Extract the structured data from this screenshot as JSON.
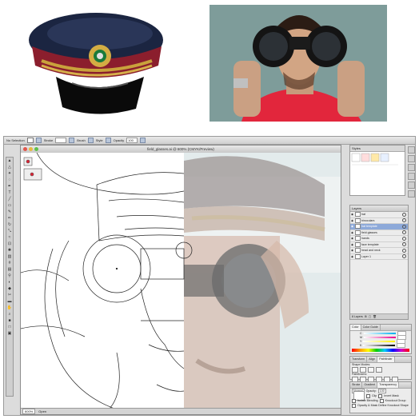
{
  "control_bar": {
    "selection": "No Selection",
    "stroke_label": "Stroke",
    "brush_label": "Brush",
    "style_label": "Style",
    "opacity_label": "Opacity",
    "opacity_value": "100"
  },
  "document": {
    "title": "field_glasses.ai @ 600% (CMYK/Preview)"
  },
  "status": {
    "zoom": "600%",
    "state": "Open"
  },
  "graphic_styles": {
    "tab": "Styles"
  },
  "layers_panel": {
    "tab": "Layers",
    "layers": [
      {
        "name": "hat",
        "selected": false
      },
      {
        "name": "binoculars",
        "selected": false
      },
      {
        "name": "hat template",
        "selected": true
      },
      {
        "name": "field glasses",
        "selected": false
      },
      {
        "name": "hands",
        "selected": false
      },
      {
        "name": "face template",
        "selected": false
      },
      {
        "name": "head and neck",
        "selected": false
      },
      {
        "name": "Layer 1",
        "selected": false
      }
    ],
    "footer": "8 Layers"
  },
  "color_panel": {
    "tabs": [
      "Color",
      "Color Guide"
    ],
    "channels": [
      "C",
      "M",
      "Y",
      "K"
    ]
  },
  "pathfinder_panel": {
    "tabs": [
      "Transform",
      "Align",
      "Pathfinder"
    ],
    "shape_modes": "Shape Modes:",
    "pathfinders": "Pathfinders:"
  },
  "transparency_panel": {
    "tabs": [
      "Stroke",
      "Gradient",
      "Transparency"
    ],
    "mode": "Normal",
    "opacity_label": "Opacity:",
    "opacity_value": "100",
    "options": [
      "Isolate Blending",
      "Knockout Group",
      "Opacity & Mask Define Knockout Shape"
    ],
    "clip": "Clip",
    "invert": "Invert Mask"
  },
  "colors": {
    "panel_bg": "#dcdcdc",
    "selection_highlight": "#8da9d9",
    "cap_band": "#8b1e2d",
    "cap_crown": "#1a2440",
    "shirt": "#e2263c"
  }
}
